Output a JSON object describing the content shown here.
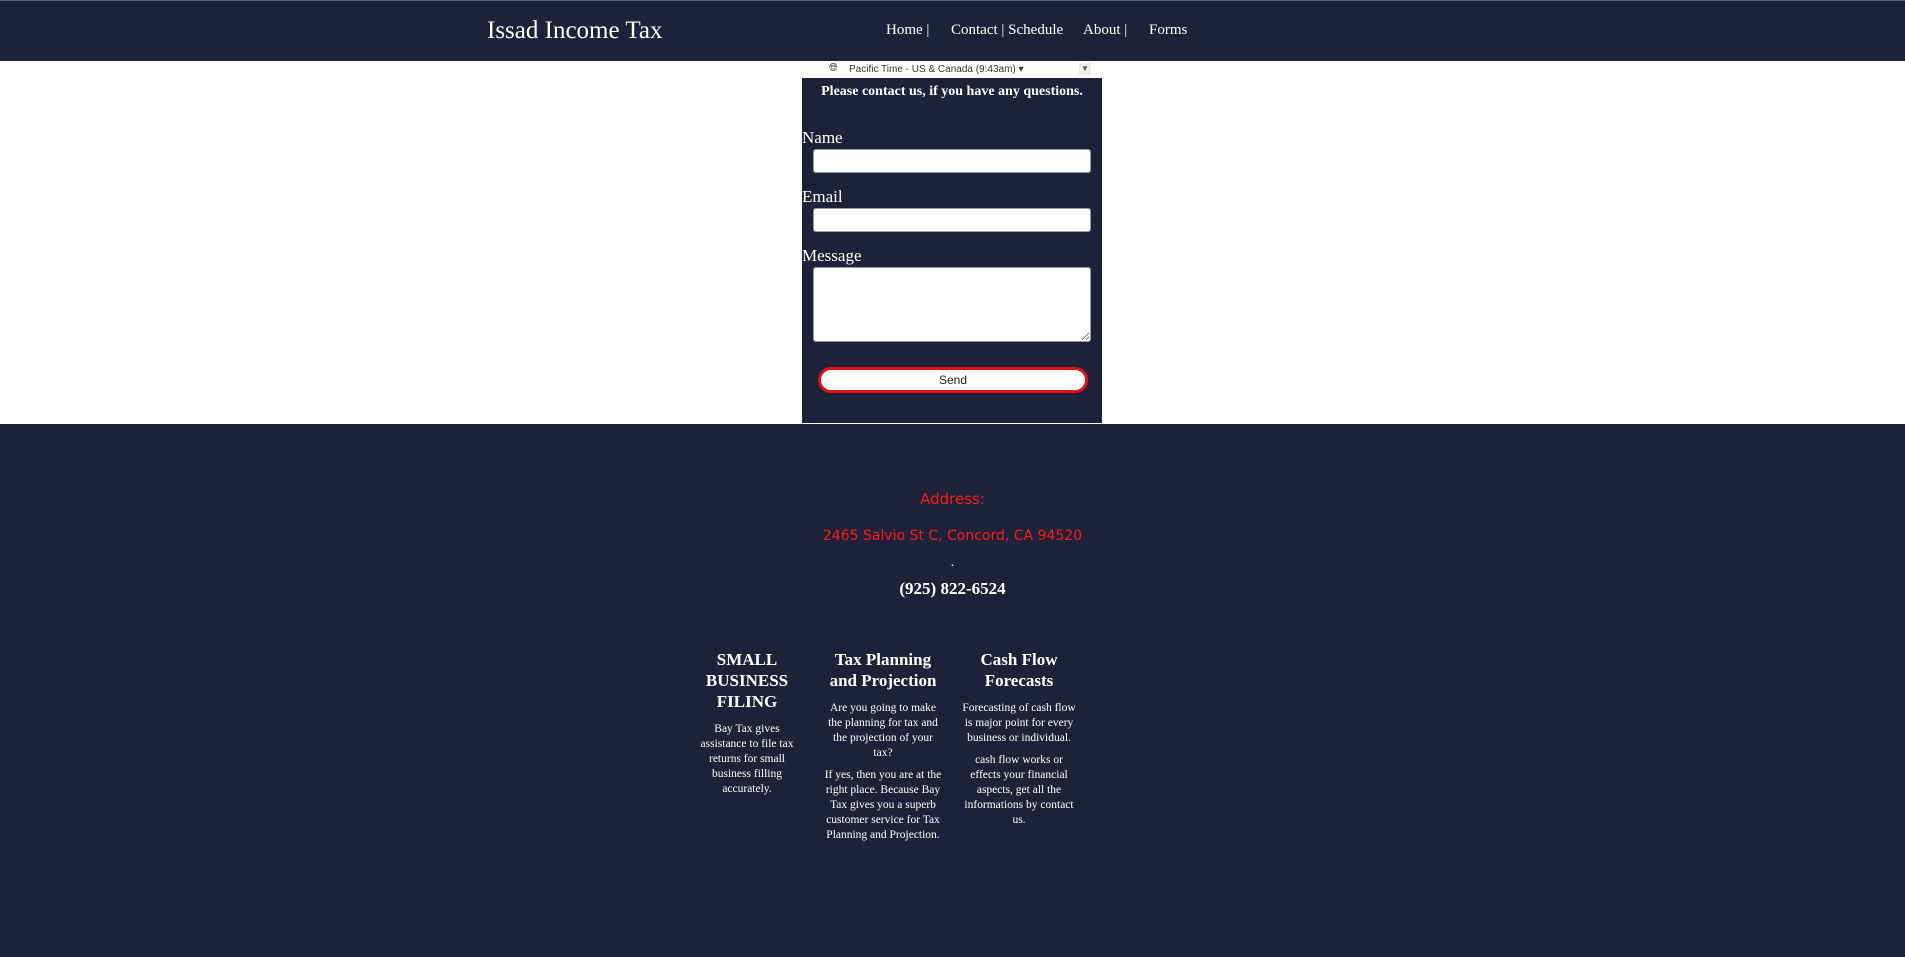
{
  "header": {
    "brand": "Issad Income Tax",
    "nav": [
      "Home |",
      "Contact | Schedule",
      "About |",
      "Forms"
    ]
  },
  "timezone": {
    "label": "Pacific Time - US & Canada (9:43am) ▾",
    "globe_icon": "globe-icon"
  },
  "contact_form": {
    "heading": "Please contact us, if you have any questions.",
    "name_label": "Name",
    "name_value": "",
    "email_label": "Email",
    "email_value": "",
    "message_label": "Message",
    "message_value": "",
    "send_label": "Send"
  },
  "footer": {
    "address_title": "Address:",
    "address": "2465 Salvio St C, Concord, CA 94520",
    "separator": ".",
    "phone": "(925) 822-6524",
    "services": [
      {
        "title": "SMALL BUSINESS FILING",
        "paragraphs": [
          "Bay Tax gives assistance to file tax returns for small business filling accurately."
        ]
      },
      {
        "title": "Tax Planning and Projection",
        "paragraphs": [
          "Are you going to make the planning for tax and the projection of your tax?",
          "If yes, then you are at the right place. Because Bay Tax gives you a superb customer service for Tax Planning and Projection."
        ]
      },
      {
        "title": "Cash Flow Forecasts",
        "paragraphs": [
          "Forecasting of cash flow is major point for every business or individual.",
          "cash flow works or effects your financial aspects, get all the informations by contact us."
        ]
      }
    ]
  },
  "colors": {
    "navy": "#1e2238",
    "accent_red": "#ff1a1a",
    "button_border": "#e01018"
  }
}
